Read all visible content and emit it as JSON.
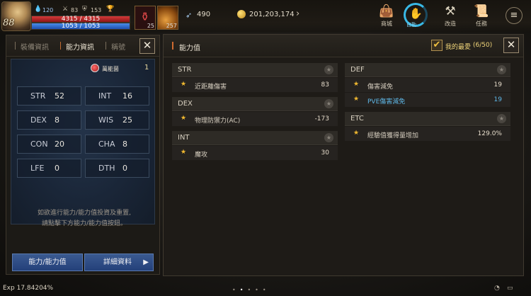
{
  "hud": {
    "level": "88",
    "top_stat_1": "120",
    "top_stat_2": "83",
    "top_stat_3": "153",
    "hp": "4315 / 4315",
    "mp": "1053 / 1053",
    "potion_count": "25",
    "skill_count": "257",
    "feather_value": "490",
    "adena": "201,203,174",
    "menu_labels": [
      "商城",
      "改造",
      "任務"
    ],
    "ring_label": "自動"
  },
  "left_panel": {
    "tabs": [
      "裝備資訊",
      "能力資訊",
      "稱號"
    ],
    "active_tab_index": 1,
    "title_name": "萬能菌",
    "title_count": "1",
    "stats": [
      {
        "key": "STR",
        "value": "52"
      },
      {
        "key": "INT",
        "value": "16"
      },
      {
        "key": "DEX",
        "value": "8"
      },
      {
        "key": "WIS",
        "value": "25"
      },
      {
        "key": "CON",
        "value": "20"
      },
      {
        "key": "CHA",
        "value": "8"
      },
      {
        "key": "LFE",
        "value": "0"
      },
      {
        "key": "DTH",
        "value": "0"
      }
    ],
    "note_line1": "如欲進行能力/能力值投資及重置,",
    "note_line2": "請點擊下方能力/能力值按鈕。",
    "button_ability": "能力/能力值",
    "button_detail": "詳細資料"
  },
  "right_panel": {
    "title": "能力值",
    "favorites_label": "我的最愛",
    "favorites_count": "(6/50)",
    "categories": [
      {
        "name": "STR",
        "rows": [
          {
            "label": "近距離傷害",
            "value": "83"
          }
        ]
      },
      {
        "name": "DEX",
        "rows": [
          {
            "label": "物理防禦力(AC)",
            "value": "-173"
          }
        ]
      },
      {
        "name": "INT",
        "rows": [
          {
            "label": "魔攻",
            "value": "30"
          }
        ]
      },
      {
        "name": "DEF",
        "rows": [
          {
            "label": "傷害減免",
            "value": "19"
          },
          {
            "label": "PVE傷害減免",
            "value": "19"
          }
        ]
      },
      {
        "name": "ETC",
        "rows": [
          {
            "label": "經驗值獲得量增加",
            "value": "129.0%"
          }
        ]
      }
    ]
  },
  "bottom": {
    "exp": "Exp 17.84204%"
  },
  "colors": {
    "accent_orange": "#d06a30",
    "star_gold": "#f0b830",
    "pve_blue": "#5fb8e8",
    "button_blue": "#2c4c86"
  }
}
